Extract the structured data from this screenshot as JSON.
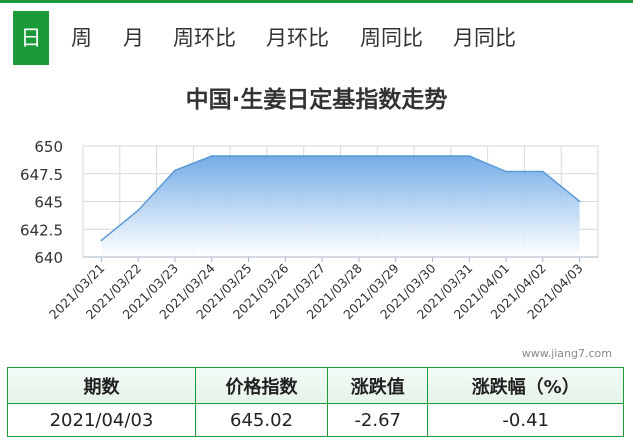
{
  "tabs": [
    "日",
    "周",
    "月",
    "周环比",
    "月环比",
    "周同比",
    "月同比"
  ],
  "active_tab": "日",
  "watermark": "www.jiang7.com",
  "table": {
    "headers": [
      "期数",
      "价格指数",
      "涨跌值",
      "涨跌幅（%）"
    ],
    "row": [
      "2021/04/03",
      "645.02",
      "-2.67",
      "-0.41"
    ]
  },
  "colors": {
    "accent": "#1c9a3a",
    "line": "#5b9bd5",
    "fill_top": "#6ea8e6",
    "fill_bottom": "#ffffff"
  },
  "chart_data": {
    "type": "area",
    "title": "中国·生姜日定基指数走势",
    "x": [
      "2021/03/21",
      "2021/03/22",
      "2021/03/23",
      "2021/03/24",
      "2021/03/25",
      "2021/03/26",
      "2021/03/27",
      "2021/03/28",
      "2021/03/29",
      "2021/03/30",
      "2021/03/31",
      "2021/04/01",
      "2021/04/02",
      "2021/04/03"
    ],
    "series": [
      {
        "values": [
          641.5,
          644.2,
          647.8,
          649.1,
          649.1,
          649.1,
          649.1,
          649.1,
          649.1,
          649.1,
          649.1,
          647.7,
          647.7,
          645.02
        ]
      }
    ],
    "ylim": [
      640,
      650
    ],
    "yticks": [
      "640",
      "642.5",
      "645",
      "647.5",
      "650"
    ],
    "grid": true
  }
}
